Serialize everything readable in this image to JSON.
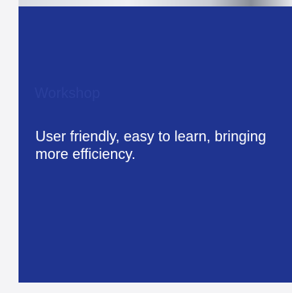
{
  "card": {
    "eyebrow": "Workshop",
    "headline": "User friendly, easy to learn, bringing more efficiency."
  }
}
